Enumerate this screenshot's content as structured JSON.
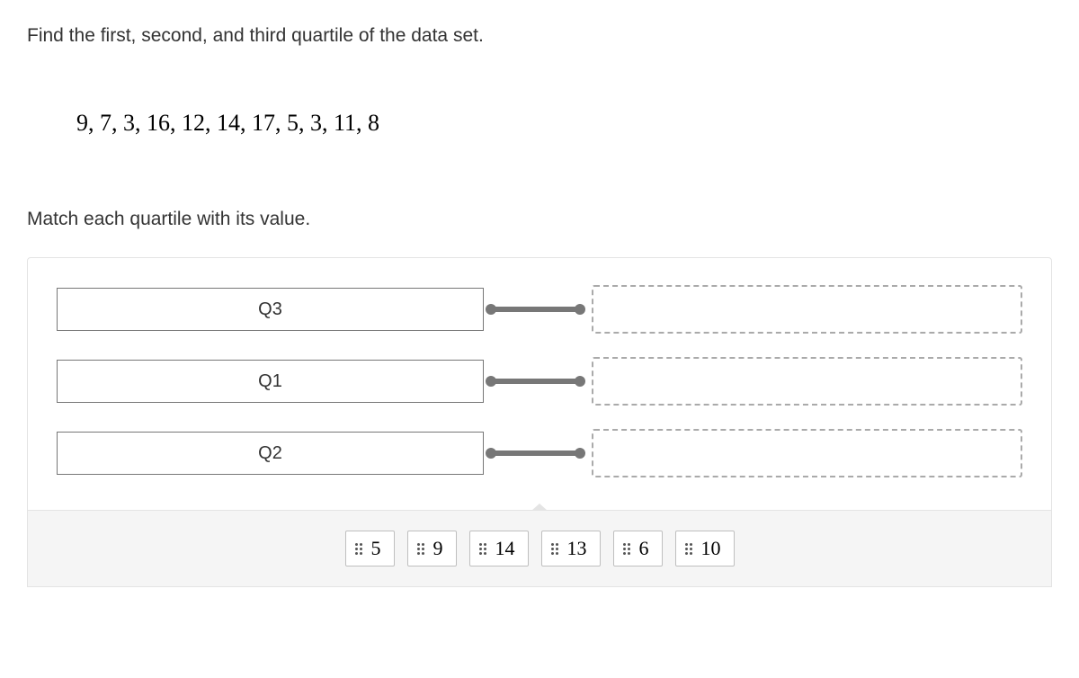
{
  "prompt": "Find the first, second, and third quartile of the data set.",
  "dataset": "9, 7, 3, 16, 12, 14, 17, 5, 3, 11, 8",
  "instruction": "Match each quartile with its value.",
  "rows": [
    {
      "label": "Q3"
    },
    {
      "label": "Q1"
    },
    {
      "label": "Q2"
    }
  ],
  "choices": [
    {
      "value": "5"
    },
    {
      "value": "9"
    },
    {
      "value": "14"
    },
    {
      "value": "13"
    },
    {
      "value": "6"
    },
    {
      "value": "10"
    }
  ]
}
